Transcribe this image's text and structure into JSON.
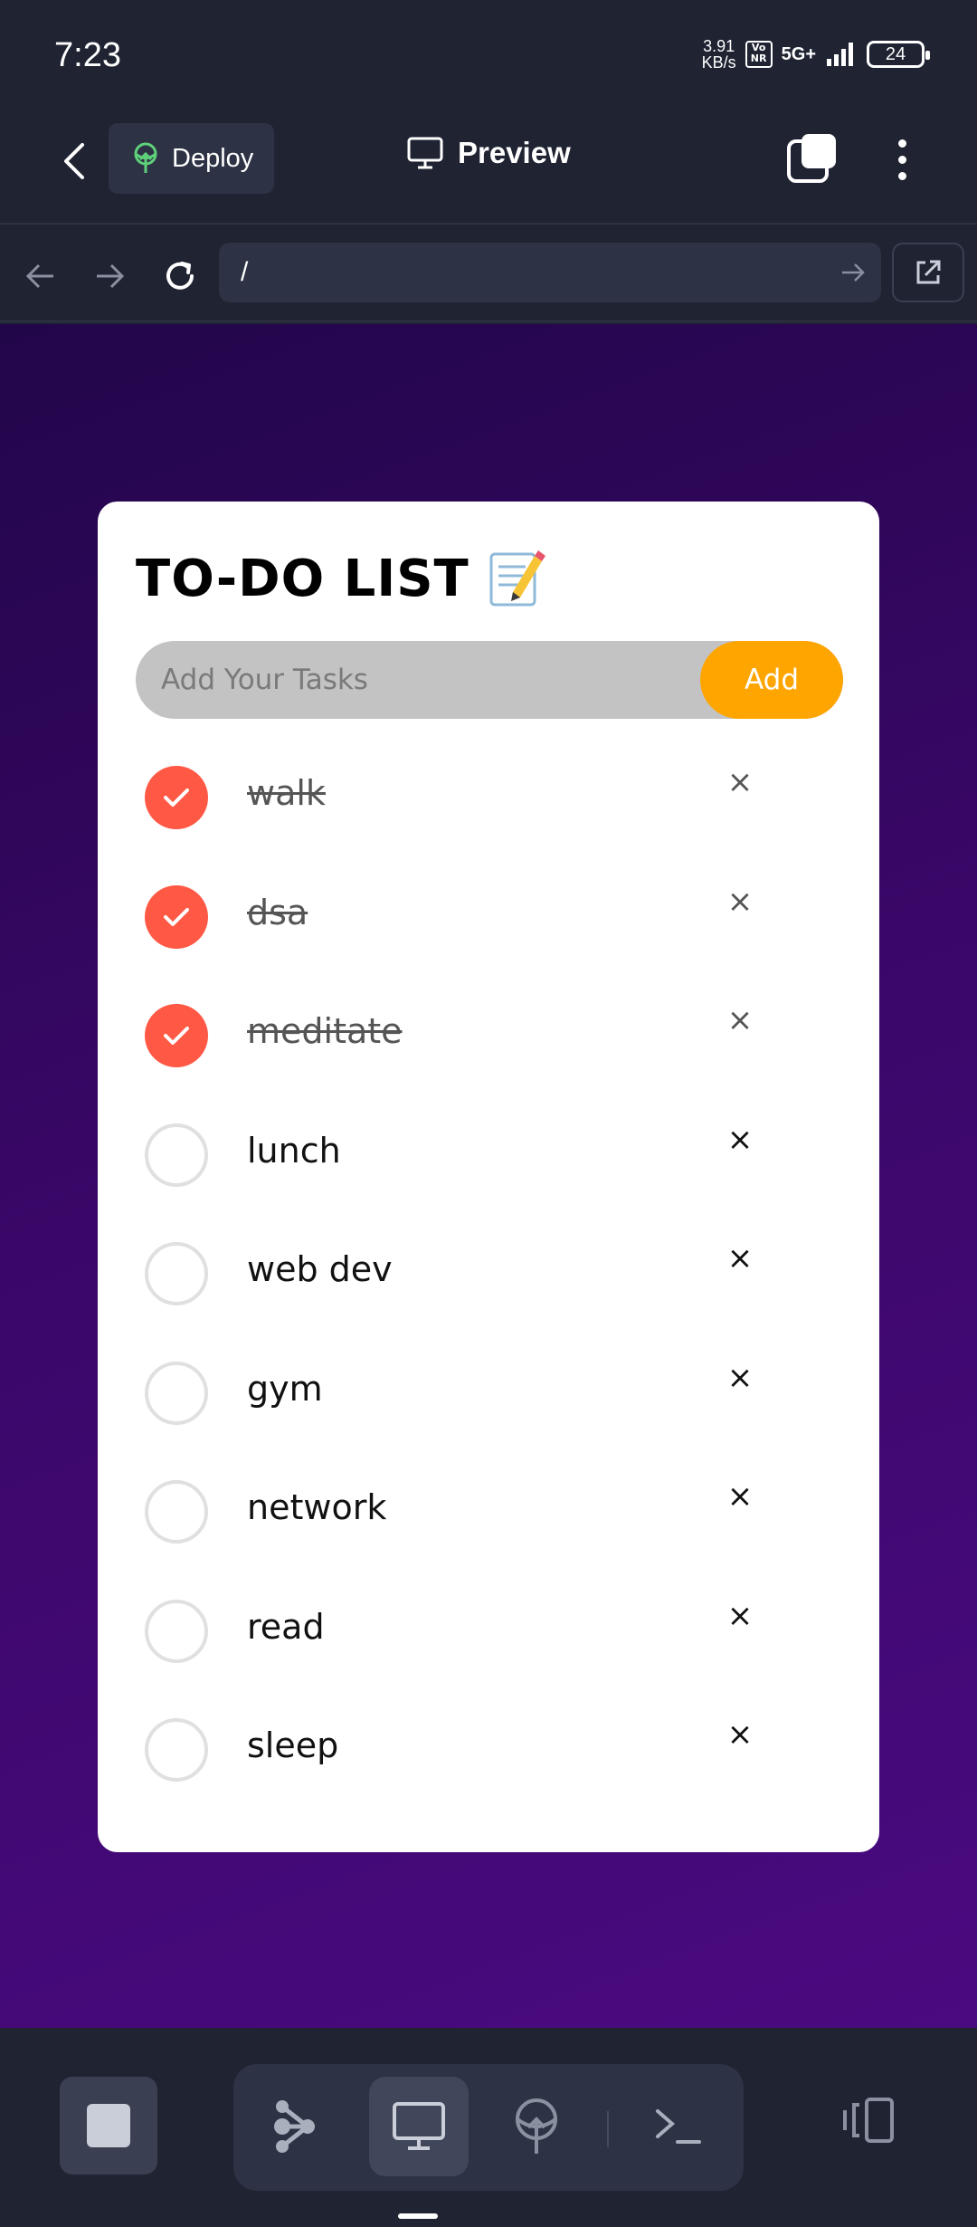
{
  "status_bar": {
    "time": "7:23",
    "speed_value": "3.91",
    "speed_unit": "KB/s",
    "volte_badge": "Vo NR",
    "network": "5G+",
    "battery": "24"
  },
  "app_bar": {
    "deploy_label": "Deploy",
    "title": "Preview"
  },
  "browser": {
    "url": "/"
  },
  "todo": {
    "title": "TO-DO LIST",
    "input_placeholder": "Add Your Tasks",
    "add_label": "Add",
    "delete_symbol": "×",
    "tasks": [
      {
        "label": "walk",
        "done": true
      },
      {
        "label": "dsa",
        "done": true
      },
      {
        "label": "meditate",
        "done": true
      },
      {
        "label": "lunch",
        "done": false
      },
      {
        "label": "web dev",
        "done": false
      },
      {
        "label": "gym",
        "done": false
      },
      {
        "label": "network",
        "done": false
      },
      {
        "label": "read",
        "done": false
      },
      {
        "label": "sleep",
        "done": false
      }
    ]
  },
  "colors": {
    "accent_add": "#ffa500",
    "check_done": "#ff5945",
    "preview_bg": "#3a0768"
  },
  "bottom_bar": {
    "icons": [
      "stop-icon",
      "workflow-icon",
      "preview-icon",
      "deploy-icon",
      "terminal-icon",
      "device-icon"
    ]
  }
}
